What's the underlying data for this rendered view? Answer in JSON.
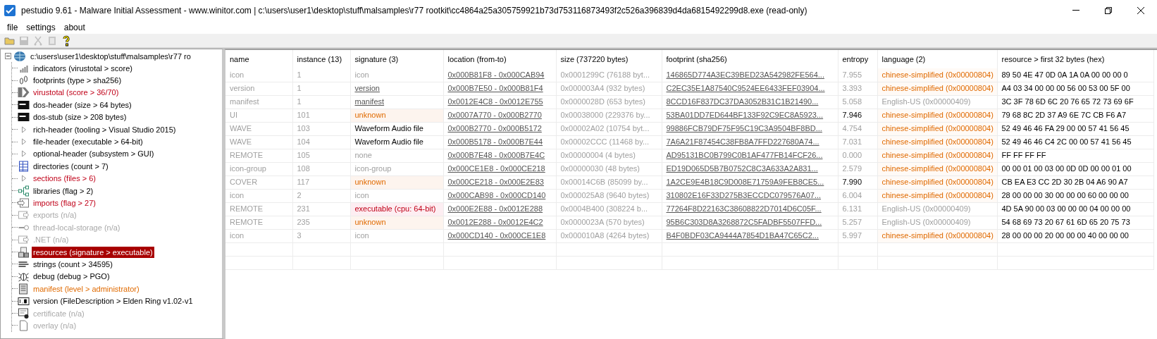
{
  "window": {
    "title": "pestudio 9.61 - Malware Initial Assessment - www.winitor.com | c:\\users\\user1\\desktop\\stuff\\malsamples\\r77 rootkit\\cc4864a25a305759921b73d753116873493f2c526a396839d4da6815492299d8.exe (read-only)"
  },
  "menu": [
    "file",
    "settings",
    "about"
  ],
  "toolbar": [
    {
      "kind": "open",
      "disabled": false
    },
    {
      "kind": "save",
      "disabled": true
    },
    {
      "kind": "cut",
      "disabled": true
    },
    {
      "kind": "paste",
      "disabled": true
    },
    {
      "kind": "help",
      "disabled": false
    }
  ],
  "tree": {
    "label": "c:\\users\\user1\\desktop\\stuff\\malsamples\\r77 ro",
    "expanded": true,
    "children": [
      {
        "label": "indicators (virustotal > score)",
        "kind": "bars",
        "flagged": false,
        "warning": false,
        "disabled": false,
        "selected": false
      },
      {
        "label": "footprints (type > sha256)",
        "kind": "footprint",
        "flagged": false,
        "warning": false,
        "disabled": false,
        "selected": false
      },
      {
        "label": "virustotal (score > 36/70)",
        "kind": "chevron",
        "flagged": true,
        "warning": false,
        "disabled": false,
        "selected": false
      },
      {
        "label": "dos-header (size > 64 bytes)",
        "kind": "console",
        "flagged": false,
        "warning": false,
        "disabled": false,
        "selected": false
      },
      {
        "label": "dos-stub (size > 208 bytes)",
        "kind": "console",
        "flagged": false,
        "warning": false,
        "disabled": false,
        "selected": false
      },
      {
        "label": "rich-header (tooling > Visual Studio 2015)",
        "kind": "triangle",
        "flagged": false,
        "warning": false,
        "disabled": false,
        "selected": false
      },
      {
        "label": "file-header (executable > 64-bit)",
        "kind": "triangle",
        "flagged": false,
        "warning": false,
        "disabled": false,
        "selected": false
      },
      {
        "label": "optional-header (subsystem > GUI)",
        "kind": "triangle",
        "flagged": false,
        "warning": false,
        "disabled": false,
        "selected": false
      },
      {
        "label": "directories (count > 7)",
        "kind": "grid",
        "flagged": false,
        "warning": false,
        "disabled": false,
        "selected": false
      },
      {
        "label": "sections (files > 6)",
        "kind": "triangle",
        "flagged": true,
        "warning": false,
        "disabled": false,
        "selected": false
      },
      {
        "label": "libraries (flag > 2)",
        "kind": "network",
        "flagged": false,
        "warning": false,
        "disabled": false,
        "selected": false
      },
      {
        "label": "imports (flag > 27)",
        "kind": "import",
        "flagged": true,
        "warning": false,
        "disabled": false,
        "selected": false
      },
      {
        "label": "exports (n/a)",
        "kind": "export",
        "flagged": false,
        "warning": false,
        "disabled": true,
        "selected": false
      },
      {
        "label": "thread-local-storage (n/a)",
        "kind": "key",
        "flagged": false,
        "warning": false,
        "disabled": true,
        "selected": false
      },
      {
        "label": ".NET (n/a)",
        "kind": "export",
        "flagged": false,
        "warning": false,
        "disabled": true,
        "selected": false
      },
      {
        "label": "resources (signature > executable)",
        "kind": "resources",
        "flagged": false,
        "warning": false,
        "disabled": false,
        "selected": true
      },
      {
        "label": "strings (count > 34595)",
        "kind": "text",
        "flagged": false,
        "warning": false,
        "disabled": false,
        "selected": false
      },
      {
        "label": "debug (debug > PGO)",
        "kind": "bug",
        "flagged": false,
        "warning": false,
        "disabled": false,
        "selected": false
      },
      {
        "label": "manifest (level > administrator)",
        "kind": "manifest",
        "flagged": false,
        "warning": true,
        "disabled": false,
        "selected": false
      },
      {
        "label": "version (FileDescription > Elden Ring v1.02-v1",
        "kind": "version",
        "flagged": false,
        "warning": false,
        "disabled": false,
        "selected": false
      },
      {
        "label": "certificate (n/a)",
        "kind": "certificate",
        "flagged": false,
        "warning": false,
        "disabled": true,
        "selected": false
      },
      {
        "label": "overlay (n/a)",
        "kind": "page",
        "flagged": false,
        "warning": false,
        "disabled": true,
        "selected": false
      }
    ]
  },
  "table": {
    "columns": [
      "name",
      "instance (13)",
      "signature (3)",
      "location (from-to)",
      "size (737220 bytes)",
      "footprint (sha256)",
      "entropy",
      "language (2)",
      "resource > first 32 bytes (hex)"
    ],
    "rows": [
      {
        "name": "icon",
        "instance": "1",
        "signature": {
          "text": "icon",
          "kind": "plain"
        },
        "location": "0x000B81F8 - 0x000CAB94",
        "size": "0x0001299C (76188 byt...",
        "footprint": "146865D774A3EC39BED23A542982FE564...",
        "entropy": {
          "text": "7.955",
          "high": false
        },
        "language": {
          "text": "chinese-simplified (0x00000804)",
          "flagged": true
        },
        "resource": "89 50 4E 47 0D 0A 1A 0A 00 00 00 0"
      },
      {
        "name": "version",
        "instance": "1",
        "signature": {
          "text": "version",
          "kind": "link"
        },
        "location": "0x000B7E50 - 0x000B81F4",
        "size": "0x000003A4 (932 bytes)",
        "footprint": "C2EC35E1A87540C9524EE6433FEF03904...",
        "entropy": {
          "text": "3.393",
          "high": false
        },
        "language": {
          "text": "chinese-simplified (0x00000804)",
          "flagged": true
        },
        "resource": "A4 03 34 00 00 00 56 00 53 00 5F 00"
      },
      {
        "name": "manifest",
        "instance": "1",
        "signature": {
          "text": "manifest",
          "kind": "link"
        },
        "location": "0x0012E4C8 - 0x0012E755",
        "size": "0x0000028D (653 bytes)",
        "footprint": "8CCD16F837DC37DA3052B31C1B21490...",
        "entropy": {
          "text": "5.058",
          "high": false
        },
        "language": {
          "text": "English-US (0x00000409)",
          "flagged": false
        },
        "resource": "3C 3F 78 6D 6C 20 76 65 72 73 69 6F"
      },
      {
        "name": "UI",
        "instance": "101",
        "signature": {
          "text": "unknown",
          "kind": "unknown"
        },
        "location": "0x0007A770 - 0x000B2770",
        "size": "0x00038000 (229376 by...",
        "footprint": "53BA01DD7ED644BF133F92C9EC8A5923...",
        "entropy": {
          "text": "7.946",
          "high": true
        },
        "language": {
          "text": "chinese-simplified (0x00000804)",
          "flagged": true
        },
        "resource": "79 68 8C 2D 37 A9 6E 7C CB F6 A7"
      },
      {
        "name": "WAVE",
        "instance": "103",
        "signature": {
          "text": "Waveform Audio file",
          "kind": "known"
        },
        "location": "0x000B2770 - 0x000B5172",
        "size": "0x00002A02 (10754 byt...",
        "footprint": "99886FCB79DF75F95C19C3A9504BF8BD...",
        "entropy": {
          "text": "4.754",
          "high": false
        },
        "language": {
          "text": "chinese-simplified (0x00000804)",
          "flagged": true
        },
        "resource": "52 49 46 46 FA 29 00 00 57 41 56 45"
      },
      {
        "name": "WAVE",
        "instance": "104",
        "signature": {
          "text": "Waveform Audio file",
          "kind": "known"
        },
        "location": "0x000B5178 - 0x000B7E44",
        "size": "0x00002CCC (11468 by...",
        "footprint": "7A6A21F87454C38FB8A7FFD227680A74...",
        "entropy": {
          "text": "7.031",
          "high": false
        },
        "language": {
          "text": "chinese-simplified (0x00000804)",
          "flagged": true
        },
        "resource": "52 49 46 46 C4 2C 00 00 57 41 56 45"
      },
      {
        "name": "REMOTE",
        "instance": "105",
        "signature": {
          "text": "none",
          "kind": "plain"
        },
        "location": "0x000B7E48 - 0x000B7E4C",
        "size": "0x00000004 (4 bytes)",
        "footprint": "AD95131BC0B799C0B1AF477FB14FCF26...",
        "entropy": {
          "text": "0.000",
          "high": false
        },
        "language": {
          "text": "chinese-simplified (0x00000804)",
          "flagged": true
        },
        "resource": "FF FF FF FF"
      },
      {
        "name": "icon-group",
        "instance": "108",
        "signature": {
          "text": "icon-group",
          "kind": "plain"
        },
        "location": "0x000CE1E8 - 0x000CE218",
        "size": "0x00000030 (48 bytes)",
        "footprint": "ED19D065D5B7B0752C8C3A633A2A831...",
        "entropy": {
          "text": "2.579",
          "high": false
        },
        "language": {
          "text": "chinese-simplified (0x00000804)",
          "flagged": true
        },
        "resource": "00 00 01 00 03 00 0D 0D 00 00 01 00"
      },
      {
        "name": "COVER",
        "instance": "117",
        "signature": {
          "text": "unknown",
          "kind": "unknown"
        },
        "location": "0x000CE218 - 0x000E2E83",
        "size": "0x00014C6B (85099 by...",
        "footprint": "1A2CE9E4B18C9D008E71759A9FEB8CE5...",
        "entropy": {
          "text": "7.990",
          "high": true
        },
        "language": {
          "text": "chinese-simplified (0x00000804)",
          "flagged": true
        },
        "resource": "CB EA E3 CC 2D 30 2B 04 A6 90 A7"
      },
      {
        "name": "icon",
        "instance": "2",
        "signature": {
          "text": "icon",
          "kind": "plain"
        },
        "location": "0x000CAB98 - 0x000CD140",
        "size": "0x000025A8 (9640 bytes)",
        "footprint": "310802E16F33D275B3ECCDC079576A07...",
        "entropy": {
          "text": "6.004",
          "high": false
        },
        "language": {
          "text": "chinese-simplified (0x00000804)",
          "flagged": true
        },
        "resource": "28 00 00 00 30 00 00 00 60 00 00 00"
      },
      {
        "name": "REMOTE",
        "instance": "231",
        "signature": {
          "text": "executable (cpu: 64-bit)",
          "kind": "executable"
        },
        "location": "0x000E2E88 - 0x0012E288",
        "size": "0x0004B400 (308224 b...",
        "footprint": "77264F8D22163C38608822D7014D6C05F...",
        "entropy": {
          "text": "6.131",
          "high": false
        },
        "language": {
          "text": "English-US (0x00000409)",
          "flagged": false
        },
        "resource": "4D 5A 90 00 03 00 00 00 04 00 00 00"
      },
      {
        "name": "REMOTE",
        "instance": "235",
        "signature": {
          "text": "unknown",
          "kind": "unknown"
        },
        "location": "0x0012E288 - 0x0012E4C2",
        "size": "0x0000023A (570 bytes)",
        "footprint": "95B6C303D8A3268872C5FADBF5507FFD...",
        "entropy": {
          "text": "5.257",
          "high": false
        },
        "language": {
          "text": "English-US (0x00000409)",
          "flagged": false
        },
        "resource": "54 68 69 73 20 67 61 6D 65 20 75 73"
      },
      {
        "name": "icon",
        "instance": "3",
        "signature": {
          "text": "icon",
          "kind": "plain"
        },
        "location": "0x000CD140 - 0x000CE1E8",
        "size": "0x000010A8 (4264 bytes)",
        "footprint": "B4F0BDF03CA9444A7854D1BA47C65C2...",
        "entropy": {
          "text": "5.997",
          "high": false
        },
        "language": {
          "text": "chinese-simplified (0x00000804)",
          "flagged": true
        },
        "resource": "28 00 00 00 20 00 00 00 40 00 00 00"
      }
    ]
  }
}
